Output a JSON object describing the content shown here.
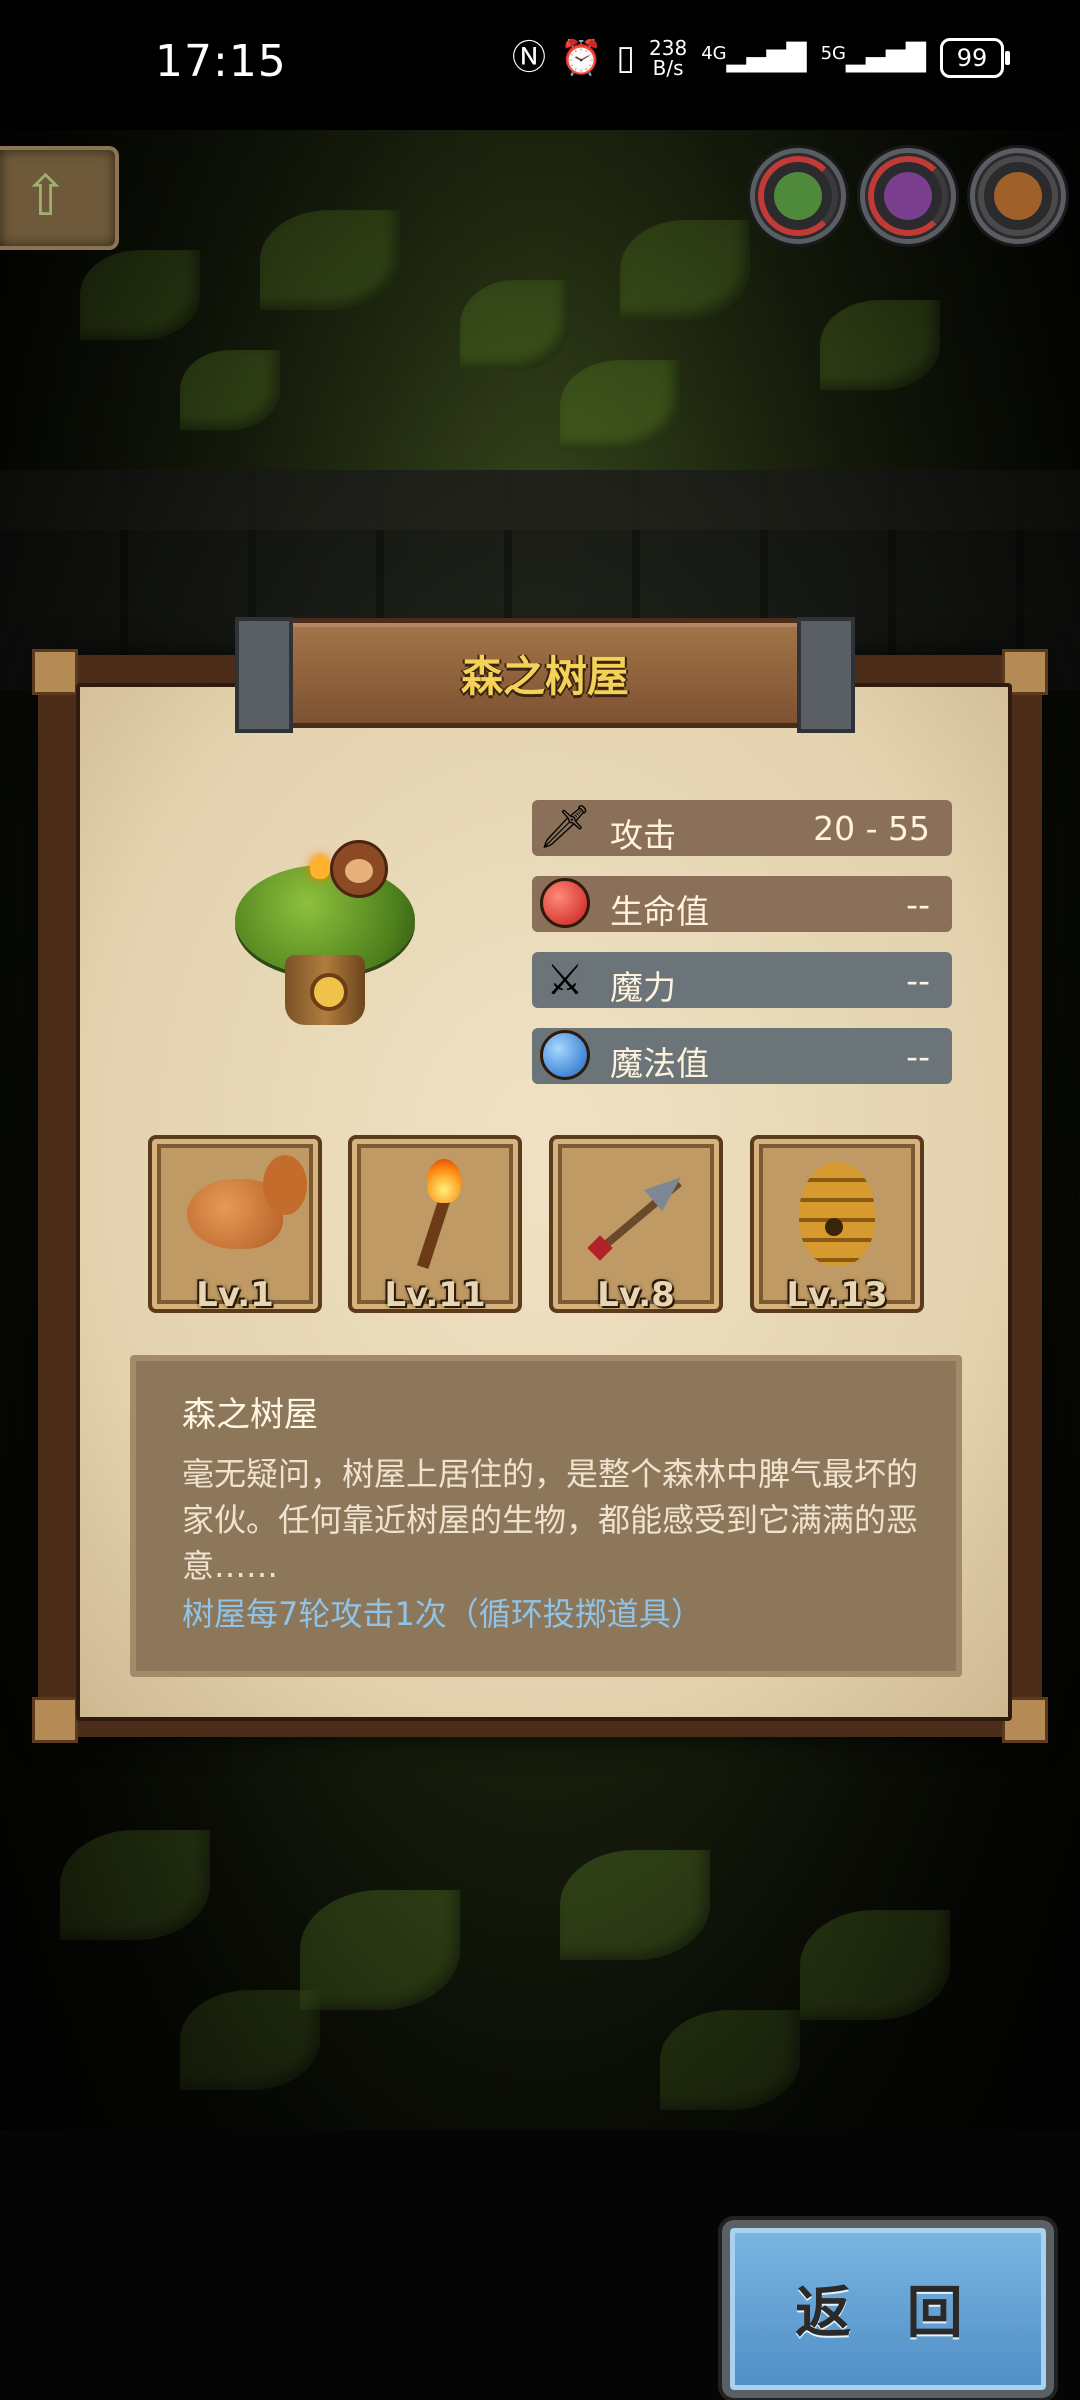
{
  "status_bar": {
    "time": "17:15",
    "net_speed_value": "238",
    "net_speed_unit": "B/s",
    "net1": "4G",
    "net2": "5G",
    "battery": "99"
  },
  "panel": {
    "title": "森之树屋",
    "stats": [
      {
        "icon": "sword-icon",
        "label": "攻击",
        "value": "20 - 55"
      },
      {
        "icon": "red-potion-icon",
        "label": "生命值",
        "value": "--"
      },
      {
        "icon": "magic-staff-icon",
        "label": "魔力",
        "value": "--"
      },
      {
        "icon": "blue-potion-icon",
        "label": "魔法值",
        "value": "--"
      }
    ],
    "items": [
      {
        "icon": "squirrel-icon",
        "level": "Lv.1"
      },
      {
        "icon": "torch-icon",
        "level": "Lv.11"
      },
      {
        "icon": "spear-icon",
        "level": "Lv.8"
      },
      {
        "icon": "beehive-icon",
        "level": "Lv.13"
      }
    ],
    "description": {
      "title": "森之树屋",
      "body": "毫无疑问，树屋上居住的，是整个森林中脾气最坏的家伙。任何靠近树屋的生物，都能感受到它满满的恶意……",
      "note": "树屋每7轮攻击1次（循环投掷道具）"
    }
  },
  "buttons": {
    "return_label": "返 回"
  },
  "colors": {
    "title_text": "#f3d257",
    "note_text": "#8fc3e8",
    "return_button": "#4f8ec6"
  }
}
